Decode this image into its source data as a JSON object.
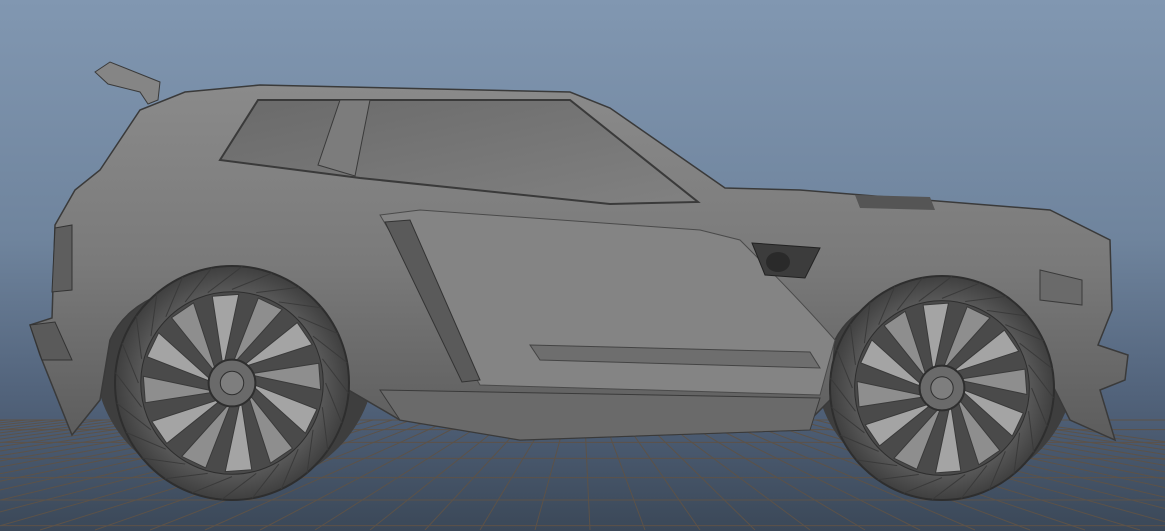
{
  "viewport": {
    "type": "3d-model-viewport",
    "colors": {
      "background_top": "#8197b1",
      "background_bottom": "#3b4858",
      "grid": "#5c5248",
      "model": "#7a7a7a",
      "model_dark": "#4a4a4a",
      "model_light": "#9a9a9a"
    }
  }
}
